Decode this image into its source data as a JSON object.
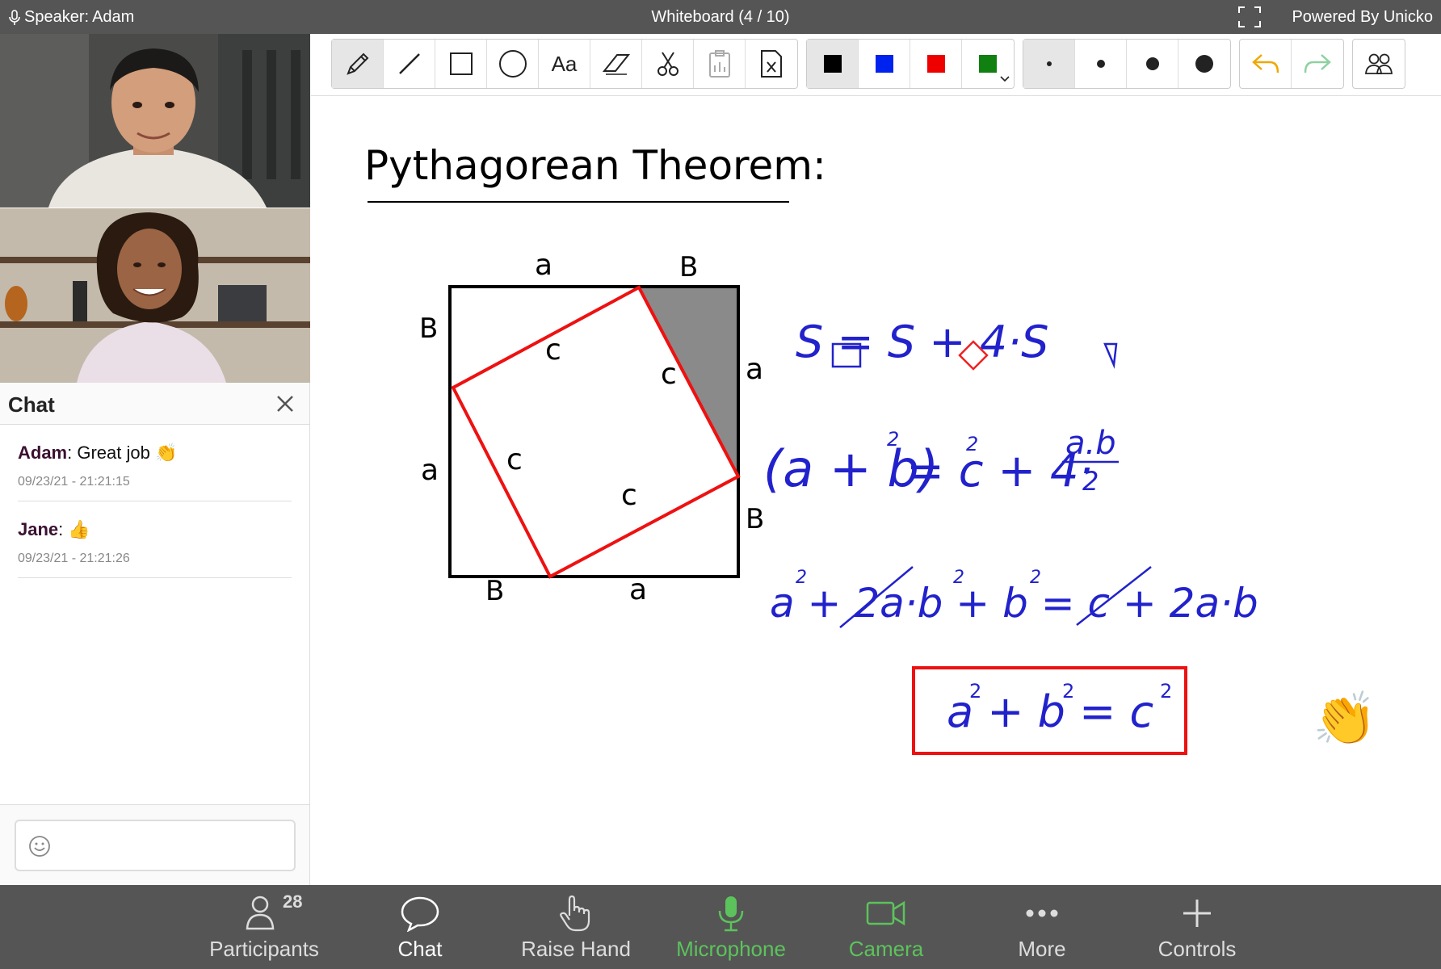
{
  "topbar": {
    "speaker_label": "Speaker:",
    "speaker_name": "Adam",
    "title": "Whiteboard (4 / 10)",
    "powered": "Powered By Unicko"
  },
  "chat": {
    "title": "Chat",
    "messages": [
      {
        "name": "Adam",
        "text": ": Great job 👏",
        "time": "09/23/21 - 21:21:15"
      },
      {
        "name": "Jane",
        "text": ": 👍",
        "time": "09/23/21 - 21:21:26"
      }
    ],
    "input_placeholder": ""
  },
  "toolbar": {
    "text_tool": "Aa",
    "colors": [
      "#000000",
      "#0022ee",
      "#ee0000",
      "#108010"
    ],
    "undo_color": "#f0a800",
    "redo_color": "#8fd1a0"
  },
  "board": {
    "title": "Pythagorean Theorem:",
    "labels": {
      "top_a": "a",
      "top_b": "B",
      "left_b": "B",
      "left_a": "a",
      "right_a": "a",
      "right_b": "B",
      "bottom_b": "B",
      "bottom_a": "a",
      "c": "c"
    },
    "eq1": "S = S + 4·S",
    "eq2_left": "(a + b)",
    "eq2_right": "= c + 4·",
    "eq2_frac_num": "a.b",
    "eq2_frac_den": "2",
    "eq3": "a + 2a·b + b = c + 2a·b",
    "result": "a + b = c",
    "exp": "2",
    "emoji": "👏"
  },
  "bottombar": {
    "participants_count": "28",
    "items": [
      "Participants",
      "Chat",
      "Raise Hand",
      "Microphone",
      "Camera",
      "More",
      "Controls"
    ]
  }
}
